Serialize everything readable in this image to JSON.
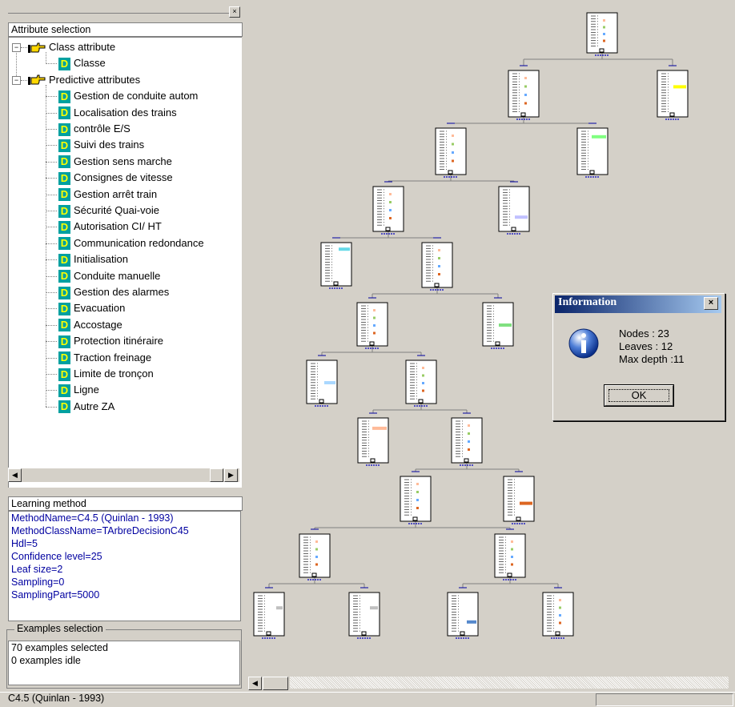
{
  "attribute_panel": {
    "title": "Attribute selection",
    "class_group": "Class attribute",
    "class_items": [
      "Classe"
    ],
    "predictive_group": "Predictive attributes",
    "predictive_items": [
      "Gestion de conduite autom",
      "Localisation des trains",
      "contrôle E/S",
      "Suivi des trains",
      "Gestion sens marche",
      "Consignes de vitesse",
      "Gestion arrêt train",
      "Sécurité Quai-voie",
      "Autorisation CI/ HT",
      "Communication  redondance",
      "Initialisation",
      "Conduite manuelle",
      "Gestion des alarmes",
      "Evacuation",
      "Accostage",
      "Protection itinéraire",
      "Traction freinage",
      "Limite de tronçon",
      "Ligne",
      "Autre ZA"
    ],
    "item_icon": "D"
  },
  "learning_method": {
    "title": "Learning method",
    "lines": [
      "MethodName=C4.5 (Quinlan - 1993)",
      "MethodClassName=TArbreDecisionC45",
      "Hdl=5",
      "Confidence level=25",
      "Leaf size=2",
      "Sampling=0",
      "SamplingPart=5000"
    ]
  },
  "examples_selection": {
    "title": "Examples selection",
    "lines": [
      "70 examples selected",
      "0 examples idle"
    ]
  },
  "status_bar": {
    "text": "C4.5 (Quinlan - 1993)"
  },
  "dialog": {
    "title": "Information",
    "close": "×",
    "lines": [
      "Nodes : 23",
      "Leaves : 12",
      "Max depth :11"
    ],
    "ok_label": "OK"
  },
  "tree": {
    "nodes": 23,
    "leaves": 12,
    "max_depth": 11
  },
  "colors": {
    "dialog_title": "#0a246a",
    "method_text": "#0000a0",
    "icon_bg": "#00a0a0",
    "icon_fg": "#ffff00"
  }
}
